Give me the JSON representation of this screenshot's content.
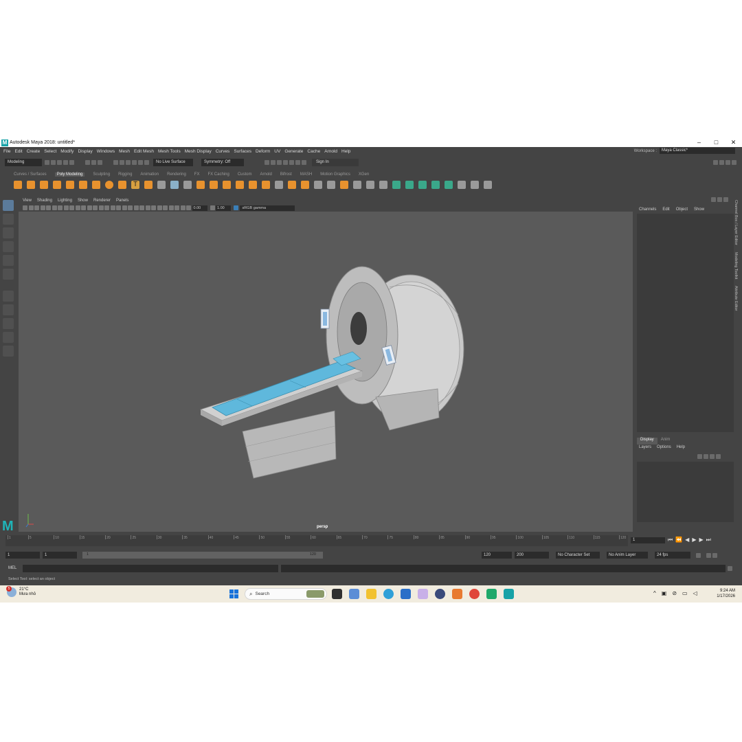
{
  "window": {
    "title": "Autodesk Maya 2018: untitled*",
    "app_icon": "M"
  },
  "window_controls": [
    "–",
    "□",
    "✕"
  ],
  "menubar": [
    "File",
    "Edit",
    "Create",
    "Select",
    "Modify",
    "Display",
    "Windows",
    "Mesh",
    "Edit Mesh",
    "Mesh Tools",
    "Mesh Display",
    "Curves",
    "Surfaces",
    "Deform",
    "UV",
    "Generate",
    "Cache",
    "Arnold",
    "Help"
  ],
  "workspace": {
    "label": "Workspace :",
    "value": "Maya Classic*"
  },
  "statusline": {
    "mode": "Modeling",
    "live_surface": "No Live Surface",
    "symmetry": "Symmetry: Off",
    "sign_in": "Sign In"
  },
  "shelf_tabs": [
    "Curves / Surfaces",
    "Poly Modeling",
    "Sculpting",
    "Rigging",
    "Animation",
    "Rendering",
    "FX",
    "FX Caching",
    "Custom",
    "Arnold",
    "Bifrost",
    "MASH",
    "Motion Graphics",
    "XGen"
  ],
  "shelf_active": "Poly Modeling",
  "viewport": {
    "menu": [
      "View",
      "Shading",
      "Lighting",
      "Show",
      "Renderer",
      "Panels"
    ],
    "exposure": "0.00",
    "gamma": "1.00",
    "color_space": "sRGB gamma",
    "camera": "persp"
  },
  "channel_box": {
    "menu": [
      "Channels",
      "Edit",
      "Object",
      "Show"
    ]
  },
  "layer_editor": {
    "tabs": [
      "Display",
      "Anim"
    ],
    "active_tab": "Display",
    "menu": [
      "Layers",
      "Options",
      "Help"
    ]
  },
  "side_tabs": [
    "Channel Box / Layer Editor",
    "Modeling Toolkit",
    "Attribute Editor"
  ],
  "timeline": {
    "ticks": [
      "1",
      "5",
      "10",
      "15",
      "20",
      "25",
      "30",
      "35",
      "40",
      "45",
      "50",
      "55",
      "60",
      "65",
      "70",
      "75",
      "80",
      "85",
      "90",
      "95",
      "100",
      "105",
      "110",
      "115",
      "120"
    ],
    "current_frame": "1"
  },
  "range": {
    "start": "1",
    "playback_start": "1",
    "slider_start": "1",
    "slider_end": "120",
    "playback_end": "120",
    "end": "200",
    "character_set": "No Character Set",
    "anim_layer": "No Anim Layer",
    "fps": "24 fps"
  },
  "command_line": {
    "label": "MEL"
  },
  "help_line": "Select Tool: select an object",
  "taskbar": {
    "weather_temp": "21°C",
    "weather_desc": "Mưa nhỏ",
    "weather_badge": "5",
    "search_placeholder": "Search",
    "time": "9:24 AM",
    "date": "1/17/2026"
  },
  "colors": {
    "maya_accent": "#17a2a7",
    "bed_blue": "#5fb8dc",
    "viewport_bg": "#5a5a5a"
  }
}
